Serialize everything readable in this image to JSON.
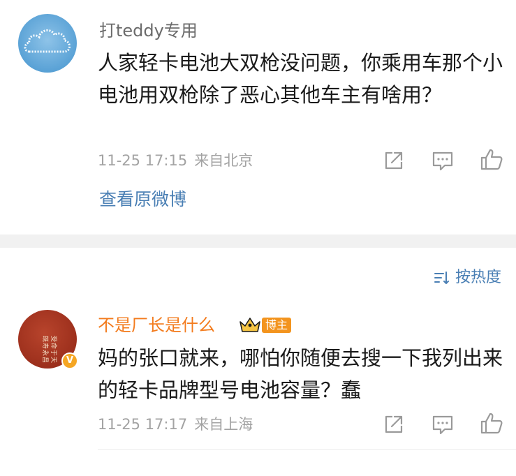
{
  "comments": [
    {
      "username": "打teddy专用",
      "text": "人家轻卡电池大双枪没问题，你乘用车那个小电池用双枪除了恶心其他车主有啥用？",
      "time": "11-25 17:15",
      "location": "来自北京",
      "view_original_label": "查看原微博",
      "avatar_icon": "cloud-avatar"
    },
    {
      "username": "不是厂长是什么",
      "badge_label": "博主",
      "text": "妈的张口就来，哪怕你随便去搜一下我列出来的轻卡品牌型号电池容量？蠢",
      "time": "11-25 17:17",
      "location": "来自上海",
      "avatar_icon": "red-seal-avatar",
      "avatar_seal_text": "受命于天既寿永昌",
      "verified_mark": "V"
    }
  ],
  "sort_label": "按热度",
  "icons": {
    "share": "share-icon",
    "comment": "comment-icon",
    "like": "thumbs-up-icon",
    "sort": "sort-icon",
    "crown": "crown-badge-icon"
  },
  "colors": {
    "link": "#4a7fb4",
    "orange_name": "#f37b1d",
    "meta_gray": "#a3a3a3",
    "badge_orange": "#f3941e"
  }
}
